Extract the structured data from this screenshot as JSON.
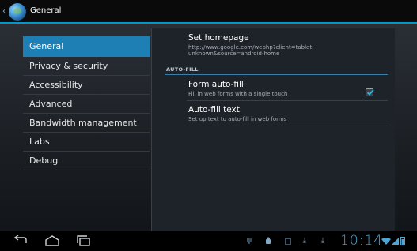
{
  "actionbar": {
    "title": "General"
  },
  "sidebar": {
    "items": [
      {
        "label": "General",
        "selected": true
      },
      {
        "label": "Privacy & security"
      },
      {
        "label": "Accessibility"
      },
      {
        "label": "Advanced"
      },
      {
        "label": "Bandwidth management"
      },
      {
        "label": "Labs"
      },
      {
        "label": "Debug"
      }
    ]
  },
  "panel": {
    "homepage": {
      "title": "Set homepage",
      "summary_line1": "http://www.google.com/webhp?client=tablet-",
      "summary_line2": "unknown&source=android-home"
    },
    "section_header": "AUTO-FILL",
    "form_autofill": {
      "title": "Form auto-fill",
      "summary": "Fill in web forms with a single touch",
      "checked": true
    },
    "autofill_text": {
      "title": "Auto-fill text",
      "summary": "Set up text to auto-fill in web forms"
    }
  },
  "statusbar": {
    "clock": "10:14"
  },
  "colors": {
    "accent": "#1d7fb3",
    "holo_blue": "#4ea6d6"
  }
}
